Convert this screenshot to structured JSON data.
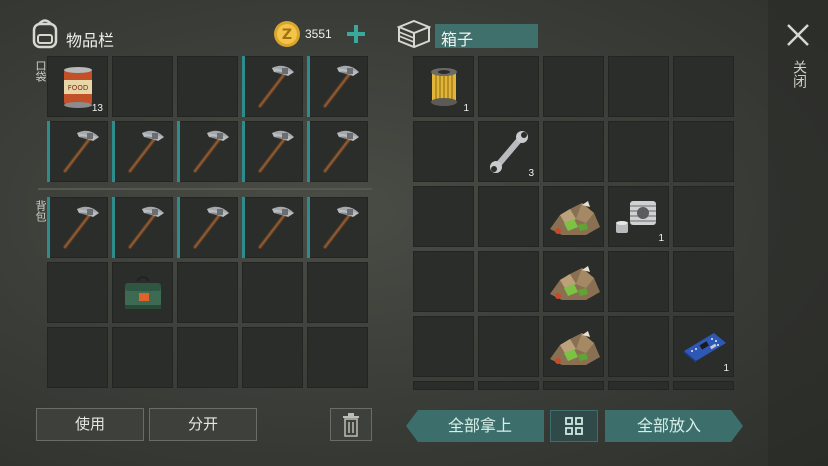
{
  "inventory": {
    "title": "物品栏",
    "coins": "3551",
    "pocket_label": "口袋",
    "backpack_label": "背包",
    "pocket_slots": [
      {
        "item": "canned-food",
        "count": "13"
      },
      {
        "item": "",
        "count": ""
      },
      {
        "item": "",
        "count": ""
      },
      {
        "item": "pickaxe",
        "count": ""
      },
      {
        "item": "pickaxe",
        "count": ""
      },
      {
        "item": "pickaxe",
        "count": ""
      },
      {
        "item": "pickaxe",
        "count": ""
      },
      {
        "item": "pickaxe",
        "count": ""
      },
      {
        "item": "pickaxe",
        "count": ""
      },
      {
        "item": "pickaxe",
        "count": ""
      }
    ],
    "backpack_slots": [
      {
        "item": "pickaxe",
        "count": ""
      },
      {
        "item": "pickaxe",
        "count": ""
      },
      {
        "item": "pickaxe",
        "count": ""
      },
      {
        "item": "pickaxe",
        "count": ""
      },
      {
        "item": "pickaxe",
        "count": ""
      },
      {
        "item": "",
        "count": ""
      },
      {
        "item": "green-bag",
        "count": ""
      },
      {
        "item": "",
        "count": ""
      },
      {
        "item": "",
        "count": ""
      },
      {
        "item": "",
        "count": ""
      },
      {
        "item": "",
        "count": ""
      },
      {
        "item": "",
        "count": ""
      },
      {
        "item": "",
        "count": ""
      },
      {
        "item": "",
        "count": ""
      },
      {
        "item": "",
        "count": ""
      }
    ],
    "use_label": "使用",
    "split_label": "分开"
  },
  "box": {
    "title": "箱子",
    "slots": [
      {
        "item": "oil-filter",
        "count": "1"
      },
      {
        "item": "",
        "count": ""
      },
      {
        "item": "",
        "count": ""
      },
      {
        "item": "",
        "count": ""
      },
      {
        "item": "",
        "count": ""
      },
      {
        "item": "",
        "count": ""
      },
      {
        "item": "wrench",
        "count": "3"
      },
      {
        "item": "",
        "count": ""
      },
      {
        "item": "",
        "count": ""
      },
      {
        "item": "",
        "count": ""
      },
      {
        "item": "",
        "count": ""
      },
      {
        "item": "",
        "count": ""
      },
      {
        "item": "ore",
        "count": ""
      },
      {
        "item": "engine-cylinder",
        "count": "1"
      },
      {
        "item": "",
        "count": ""
      },
      {
        "item": "",
        "count": ""
      },
      {
        "item": "",
        "count": ""
      },
      {
        "item": "ore",
        "count": ""
      },
      {
        "item": "",
        "count": ""
      },
      {
        "item": "",
        "count": ""
      },
      {
        "item": "",
        "count": ""
      },
      {
        "item": "",
        "count": ""
      },
      {
        "item": "ore",
        "count": ""
      },
      {
        "item": "",
        "count": ""
      },
      {
        "item": "circuit-board",
        "count": "1"
      }
    ],
    "take_all_label": "全部拿上",
    "put_all_label": "全部放入"
  },
  "close_label": "关闭",
  "colors": {
    "accent": "#3c6f6c",
    "tool_stripe": "#2f8c8c",
    "slot": "#2b2d2a"
  }
}
